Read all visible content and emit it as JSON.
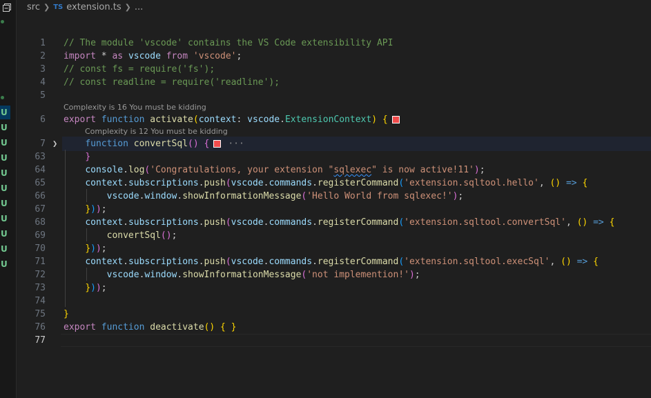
{
  "breadcrumb": {
    "folder": "src",
    "file_badge": "TS",
    "file": "extension.ts",
    "more": "..."
  },
  "sidebar": {
    "scm_status": "U"
  },
  "codelens": {
    "activate": "Complexity is 16 You must be kidding",
    "convertSql": "Complexity is 12 You must be kidding"
  },
  "lines": {
    "n1": "1",
    "n2": "2",
    "n3": "3",
    "n4": "4",
    "n5": "5",
    "n6": "6",
    "n7": "7",
    "n63": "63",
    "n64": "64",
    "n65": "65",
    "n66": "66",
    "n67": "67",
    "n68": "68",
    "n69": "69",
    "n70": "70",
    "n71": "71",
    "n72": "72",
    "n73": "73",
    "n74": "74",
    "n75": "75",
    "n76": "76",
    "n77": "77"
  },
  "code": {
    "l1": "// The module 'vscode' contains the VS Code extensibility API",
    "l3": "// const fs = require('fs');",
    "l4": "// const readline = require('readline');",
    "s_vscode": "'vscode'",
    "s_congrats_a": "'Congratulations, your extension \"",
    "s_congrats_b": "sqlexec",
    "s_congrats_c": "\" is now active!11'",
    "cmd_hello": "'extension.sqltool.hello'",
    "cmd_convert": "'extension.sqltool.convertSql'",
    "cmd_exec": "'extension.sqltool.execSql'",
    "msg_hello": "'Hello World from sqlexec!'",
    "msg_notimpl": "'not implemention!'",
    "folded": "···"
  }
}
